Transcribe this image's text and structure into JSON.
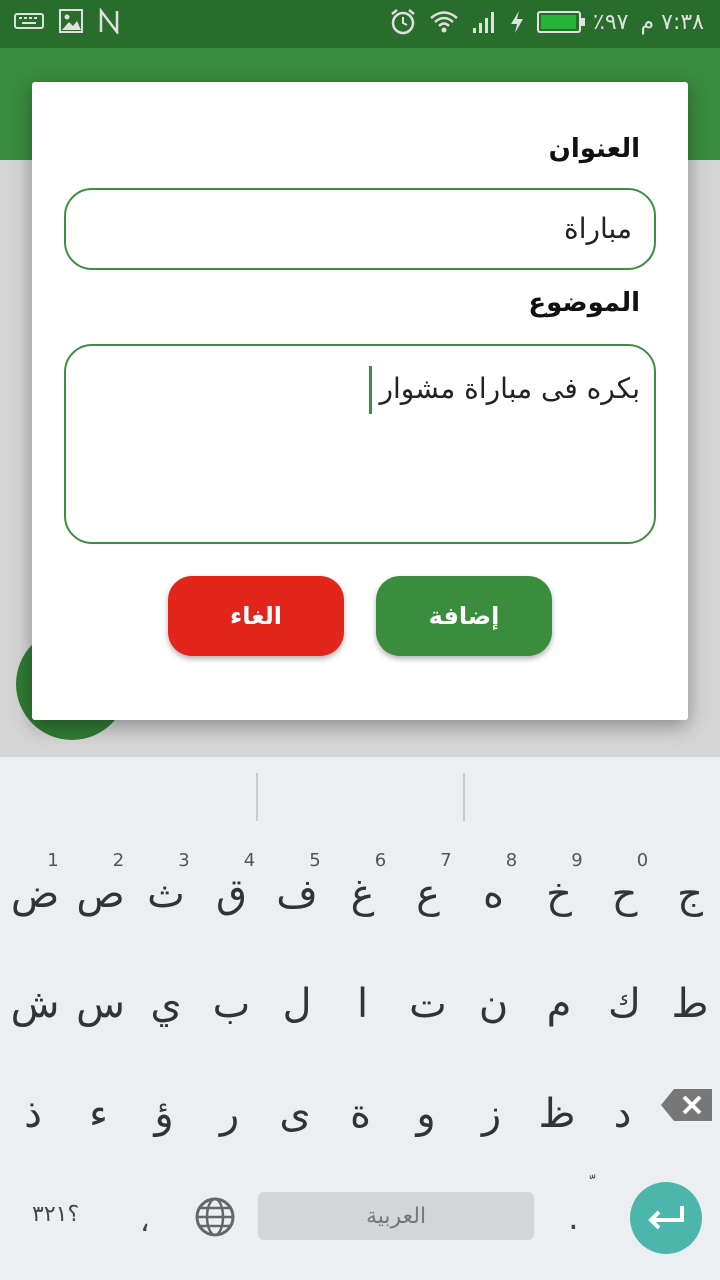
{
  "status_bar": {
    "time": "٧:٣٨ م",
    "battery": "٪٩٧",
    "battery_level": 0.97,
    "left_icons": [
      "keyboard-icon",
      "image-icon",
      "n-icon"
    ],
    "right_icons": [
      "alarm-icon",
      "wifi-icon",
      "signal-icon",
      "charging-icon",
      "battery-icon"
    ]
  },
  "dialog": {
    "title_label": "العنوان",
    "title_value": "مباراة",
    "subject_label": "الموضوع",
    "subject_value": "بكره فى مباراة مشوار",
    "add_button": "إضافة",
    "cancel_button": "الغاء"
  },
  "keyboard": {
    "row1": [
      "ض",
      "ص",
      "ث",
      "ق",
      "ف",
      "غ",
      "ع",
      "ه",
      "خ",
      "ح",
      "ج"
    ],
    "row1_numbers": [
      "1",
      "2",
      "3",
      "4",
      "5",
      "6",
      "7",
      "8",
      "9",
      "0"
    ],
    "row2": [
      "ش",
      "س",
      "ي",
      "ب",
      "ل",
      "ا",
      "ت",
      "ن",
      "م",
      "ك",
      "ط"
    ],
    "row3": [
      "ذ",
      "ء",
      "ؤ",
      "ر",
      "ى",
      "ة",
      "و",
      "ز",
      "ظ",
      "د"
    ],
    "symbols_key": "؟٣٢١",
    "comma_key": "،",
    "space_label": "العربية",
    "period_key": ".",
    "period_hint": "ّ"
  },
  "colors": {
    "primary": "#2e7d32",
    "add_button": "#3b8d3e",
    "cancel_button": "#e2261c",
    "enter_key": "#4db6ac"
  }
}
